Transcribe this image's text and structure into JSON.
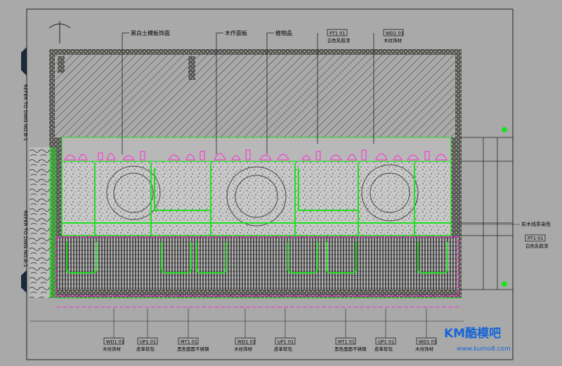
{
  "top_labels": [
    "黑白土模板饰面",
    "木作面板",
    "植物品"
  ],
  "top_tags": [
    {
      "code": "PT1 01",
      "desc": "白色乳胶漆"
    },
    {
      "code": "WD1 01",
      "desc": "木纹饰材"
    }
  ],
  "side_refs": [
    "REFER TO DWG NO.B-1",
    "REFER TO DWG NO.B-1"
  ],
  "right_notes": [
    "实木线条染色",
    "PT1 01",
    "白色乳胶漆"
  ],
  "bottom_tags": [
    {
      "code": "WD1 01",
      "desc": "木纹饰材"
    },
    {
      "code": "UP1 01",
      "desc": "皮革软包"
    },
    {
      "code": "MT1 01",
      "desc": "黑色面面不锈钢"
    },
    {
      "code": "WD1 01",
      "desc": "木纹饰材"
    },
    {
      "code": "UP1 01",
      "desc": "皮革软包"
    },
    {
      "code": "MT1 01",
      "desc": "黑色面面不锈钢"
    },
    {
      "code": "UP1 01",
      "desc": "皮革软包"
    },
    {
      "code": "WD1 01",
      "desc": "木纹饰材"
    }
  ],
  "watermark": {
    "brand": "KM酷模吧",
    "url": "www.kumo8.com"
  }
}
